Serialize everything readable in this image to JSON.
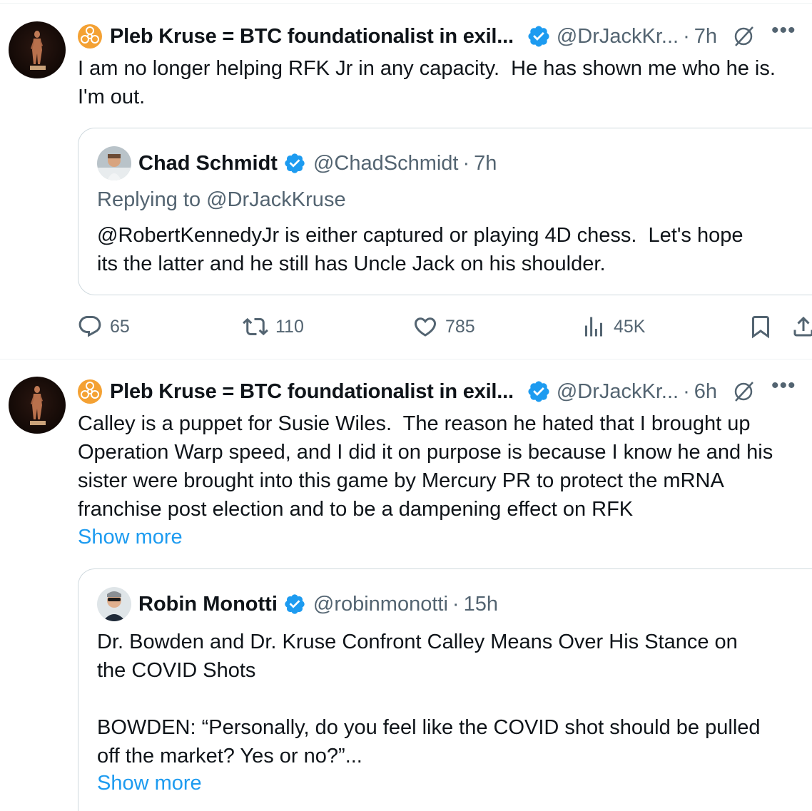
{
  "posts": [
    {
      "author": {
        "badge_icon": "biohazard-icon",
        "name": "Pleb Kruse = BTC foundationalist in exil...",
        "handle": "@DrJackKr...",
        "time": "7h"
      },
      "text": "I am no longer helping RFK Jr in any capacity.  He has shown me who he is.\nI'm out.",
      "quote": {
        "name": "Chad Schmidt",
        "handle": "@ChadSchmidt",
        "time": "7h",
        "replying_to": "Replying to @DrJackKruse",
        "text": "@RobertKennedyJr is either captured or playing 4D chess.  Let's hope\nits the latter and he still has Uncle Jack on his shoulder."
      },
      "metrics": {
        "replies": "65",
        "reposts": "110",
        "likes": "785",
        "views": "45K"
      }
    },
    {
      "author": {
        "badge_icon": "biohazard-icon",
        "name": "Pleb Kruse = BTC foundationalist in exil...",
        "handle": "@DrJackKr...",
        "time": "6h"
      },
      "text": "Calley is a puppet for Susie Wiles.  The reason he hated that I brought up\nOperation Warp speed, and I did it on purpose is because I know he and his\nsister were brought into this game by Mercury PR to protect the mRNA\nfranchise post election and to be a dampening effect on RFK",
      "show_more": "Show more",
      "quote": {
        "name": "Robin Monotti",
        "handle": "@robinmonotti",
        "time": "15h",
        "text": "Dr. Bowden and Dr. Kruse Confront Calley Means Over His Stance on\nthe COVID Shots\n\nBOWDEN: “Personally, do you feel like the COVID shot should be pulled\noff the market? Yes or no?”...",
        "show_more": "Show more"
      }
    }
  ],
  "separator": "·",
  "more_icon": "more-horizontal-icon",
  "colors": {
    "text": "#0f1419",
    "secondary": "#536471",
    "link": "#1d9bf0",
    "verified": "#1d9bf0",
    "badge": "#f4a133",
    "border": "#cfd9de"
  }
}
